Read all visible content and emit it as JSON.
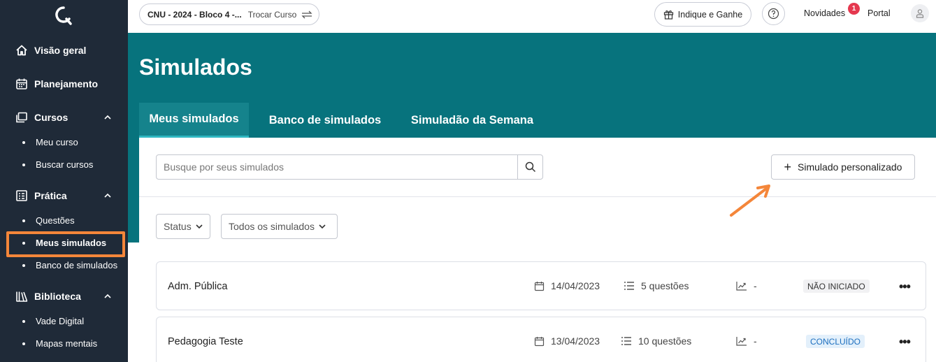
{
  "sidebar": {
    "items": [
      {
        "label": "Visão geral"
      },
      {
        "label": "Planejamento"
      },
      {
        "label": "Cursos",
        "children": [
          {
            "label": "Meu curso"
          },
          {
            "label": "Buscar cursos"
          }
        ]
      },
      {
        "label": "Prática",
        "children": [
          {
            "label": "Questões"
          },
          {
            "label": "Meus simulados"
          },
          {
            "label": "Banco de simulados"
          }
        ]
      },
      {
        "label": "Biblioteca",
        "children": [
          {
            "label": "Vade Digital"
          },
          {
            "label": "Mapas mentais"
          }
        ]
      }
    ],
    "active_item": "Meus simulados",
    "highlight_color": "#f4863a"
  },
  "topbar": {
    "course_name": "CNU - 2024 - Bloco 4 -...",
    "switch_course": "Trocar Curso",
    "refer": "Indique e Ganhe",
    "news": "Novidades",
    "news_badge": "1",
    "portal": "Portal"
  },
  "page": {
    "title": "Simulados",
    "tabs": [
      {
        "label": "Meus simulados",
        "active": true
      },
      {
        "label": "Banco de simulados",
        "active": false
      },
      {
        "label": "Simuladão da Semana",
        "active": false
      }
    ],
    "header_color": "#07737d"
  },
  "toolbar": {
    "search_placeholder": "Busque por seus simulados",
    "custom_button": "Simulado personalizado",
    "status_filter": "Status",
    "type_filter": "Todos os simulados"
  },
  "simulados": [
    {
      "name": "Adm. Pública",
      "date": "14/04/2023",
      "questions": "5 questões",
      "score": "-",
      "status": "NÃO INICIADO"
    },
    {
      "name": "Pedagogia Teste",
      "date": "13/04/2023",
      "questions": "10 questões",
      "score": "-",
      "status": "CONCLUÍDO"
    }
  ]
}
